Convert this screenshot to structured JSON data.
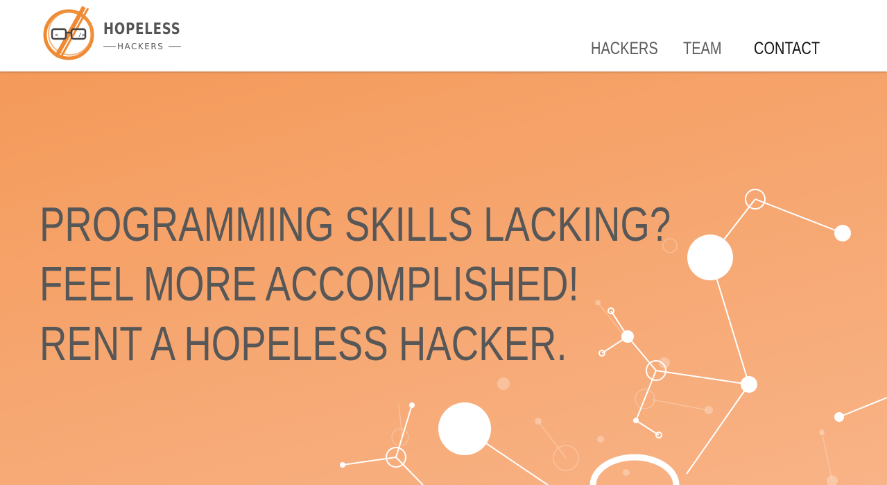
{
  "brand": {
    "name_line1": "HOPELESS",
    "name_line2": "HACKERS",
    "accent_color": "#ef8a34",
    "text_color": "#555555",
    "logo_icon": "crossed-out-glasses-icon"
  },
  "nav": {
    "items": [
      {
        "label": "HACKERS",
        "active": false
      },
      {
        "label": "TEAM",
        "active": false
      },
      {
        "label": "CONTACT",
        "active": true
      }
    ]
  },
  "hero": {
    "headline_lines": [
      "PROGRAMMING SKILLS LACKING?",
      "FEEL MORE ACCOMPLISHED!",
      "RENT A HOPELESS HACKER."
    ],
    "background_colors": [
      "#f49a5a",
      "#f8b386"
    ],
    "decoration": "network-graph-illustration"
  }
}
